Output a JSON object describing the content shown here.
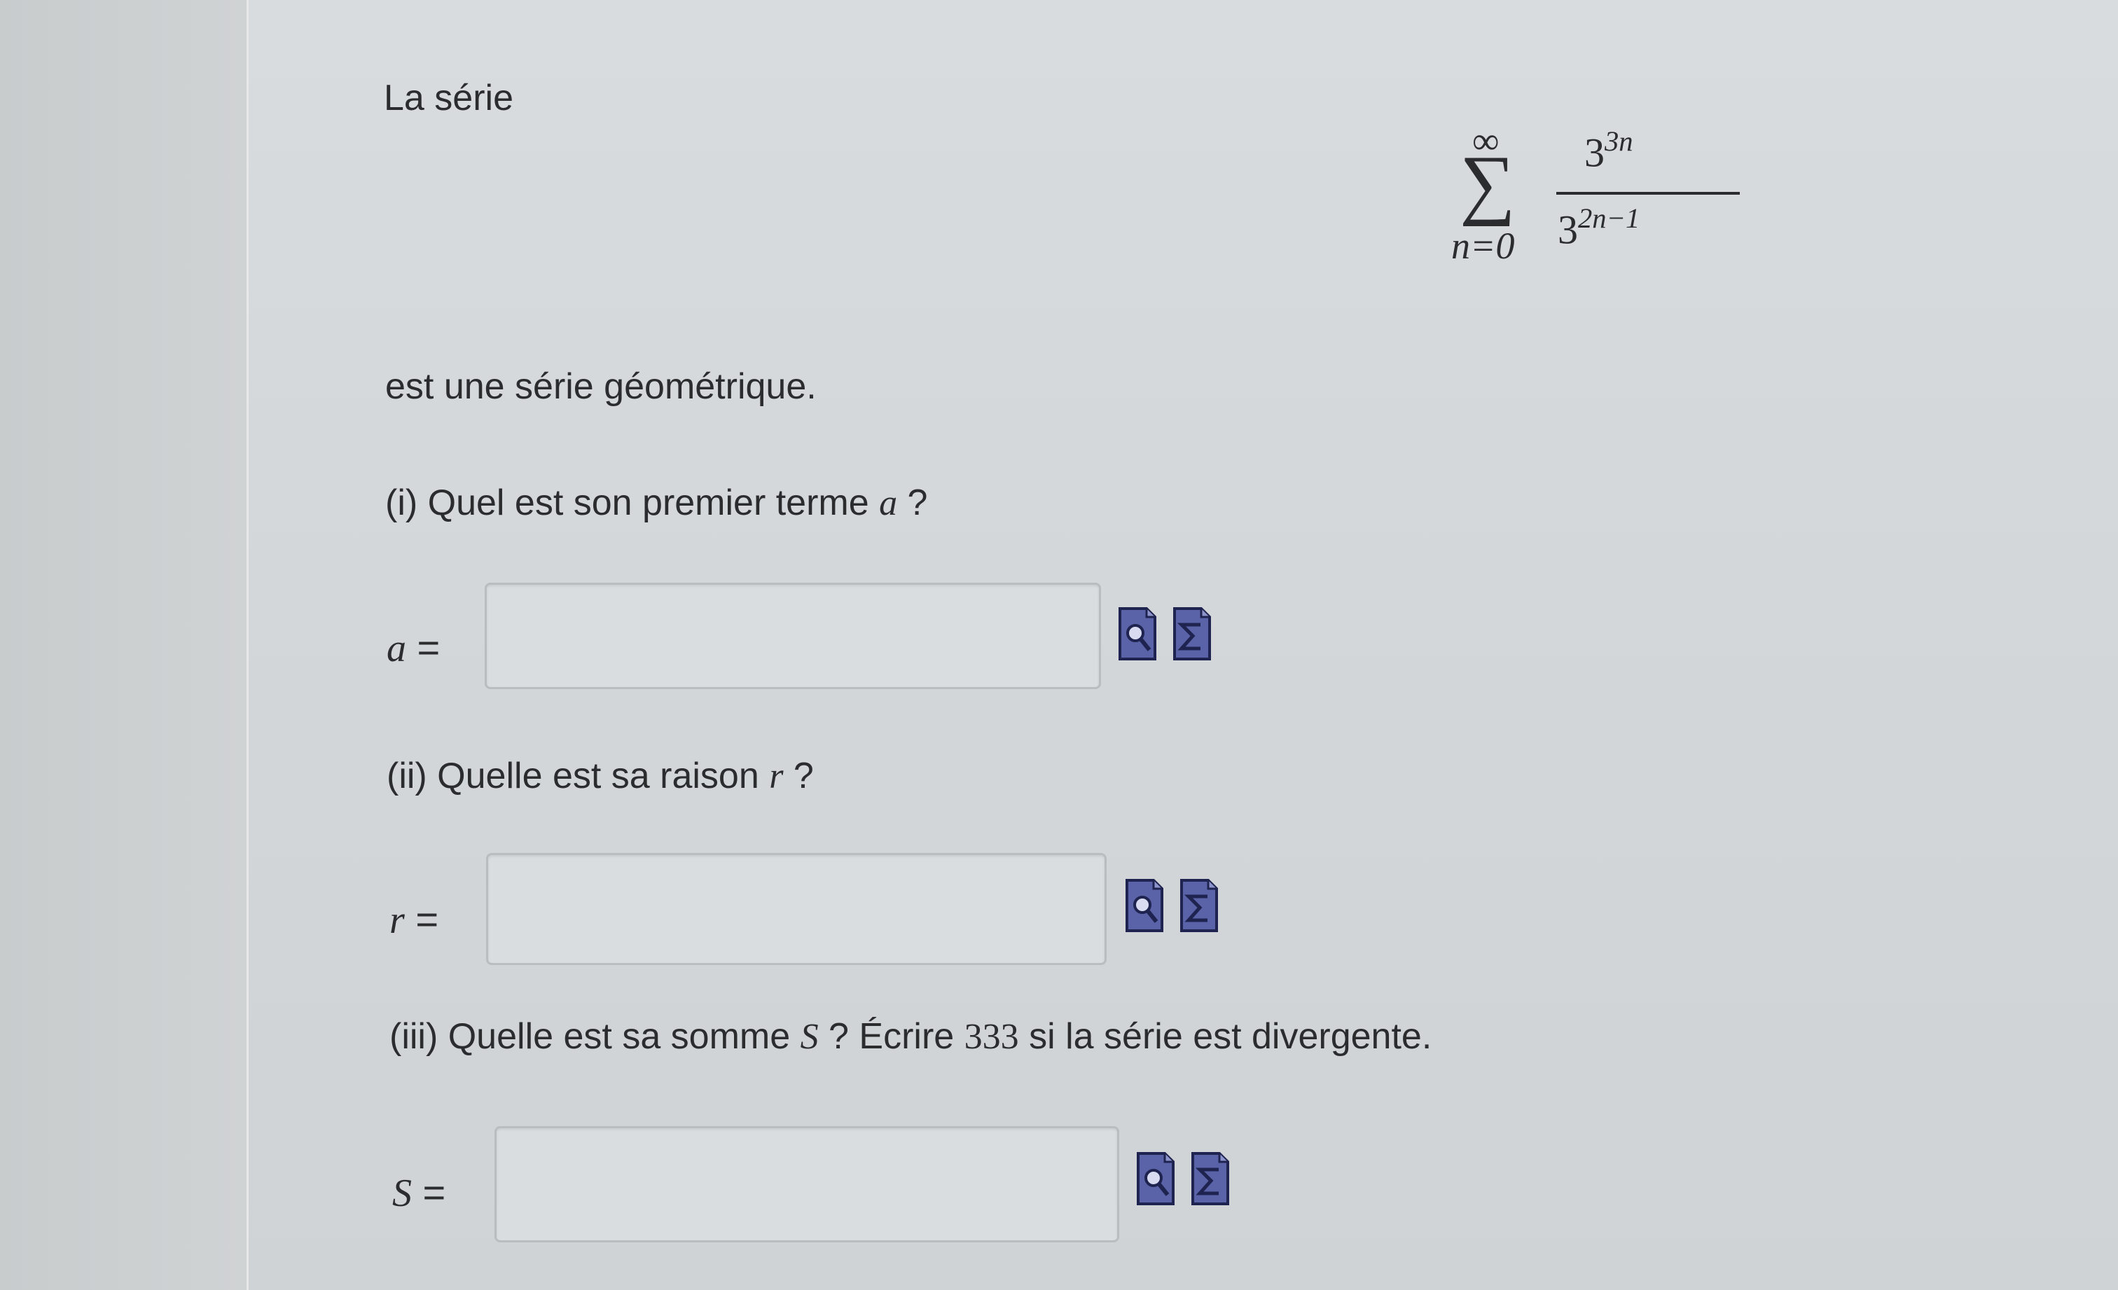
{
  "intro_text": "La série",
  "formula": {
    "upper_limit": "∞",
    "sigma": "∑",
    "lower_limit": "n=0",
    "numerator_base": "3",
    "numerator_exponent": "3n",
    "denominator_base": "3",
    "denominator_exponent": "2n−1"
  },
  "statement": "est une série géométrique.",
  "questions": [
    {
      "prompt_before": "(i) Quel est son premier terme ",
      "variable": "a",
      "prompt_after": " ?",
      "answer_label_var": "a",
      "answer_label_eq": " =",
      "input_value": "",
      "icons": [
        "preview-icon",
        "sigma-editor-icon"
      ]
    },
    {
      "prompt_before": "(ii) Quelle est sa raison ",
      "variable": "r",
      "prompt_after": " ?",
      "answer_label_var": "r",
      "answer_label_eq": " =",
      "input_value": "",
      "icons": [
        "preview-icon",
        "sigma-editor-icon"
      ]
    },
    {
      "prompt_before": "(iii) Quelle est sa somme ",
      "variable": "S",
      "prompt_middle": " ? Écrire ",
      "number": "333",
      "prompt_after": " si la série est divergente.",
      "answer_label_var": "S",
      "answer_label_eq": " =",
      "input_value": "",
      "icons": [
        "preview-icon",
        "sigma-editor-icon"
      ]
    }
  ],
  "colors": {
    "icon_fill": "#5b63a8",
    "icon_border": "#1f2350",
    "text": "#2a2c2e"
  }
}
